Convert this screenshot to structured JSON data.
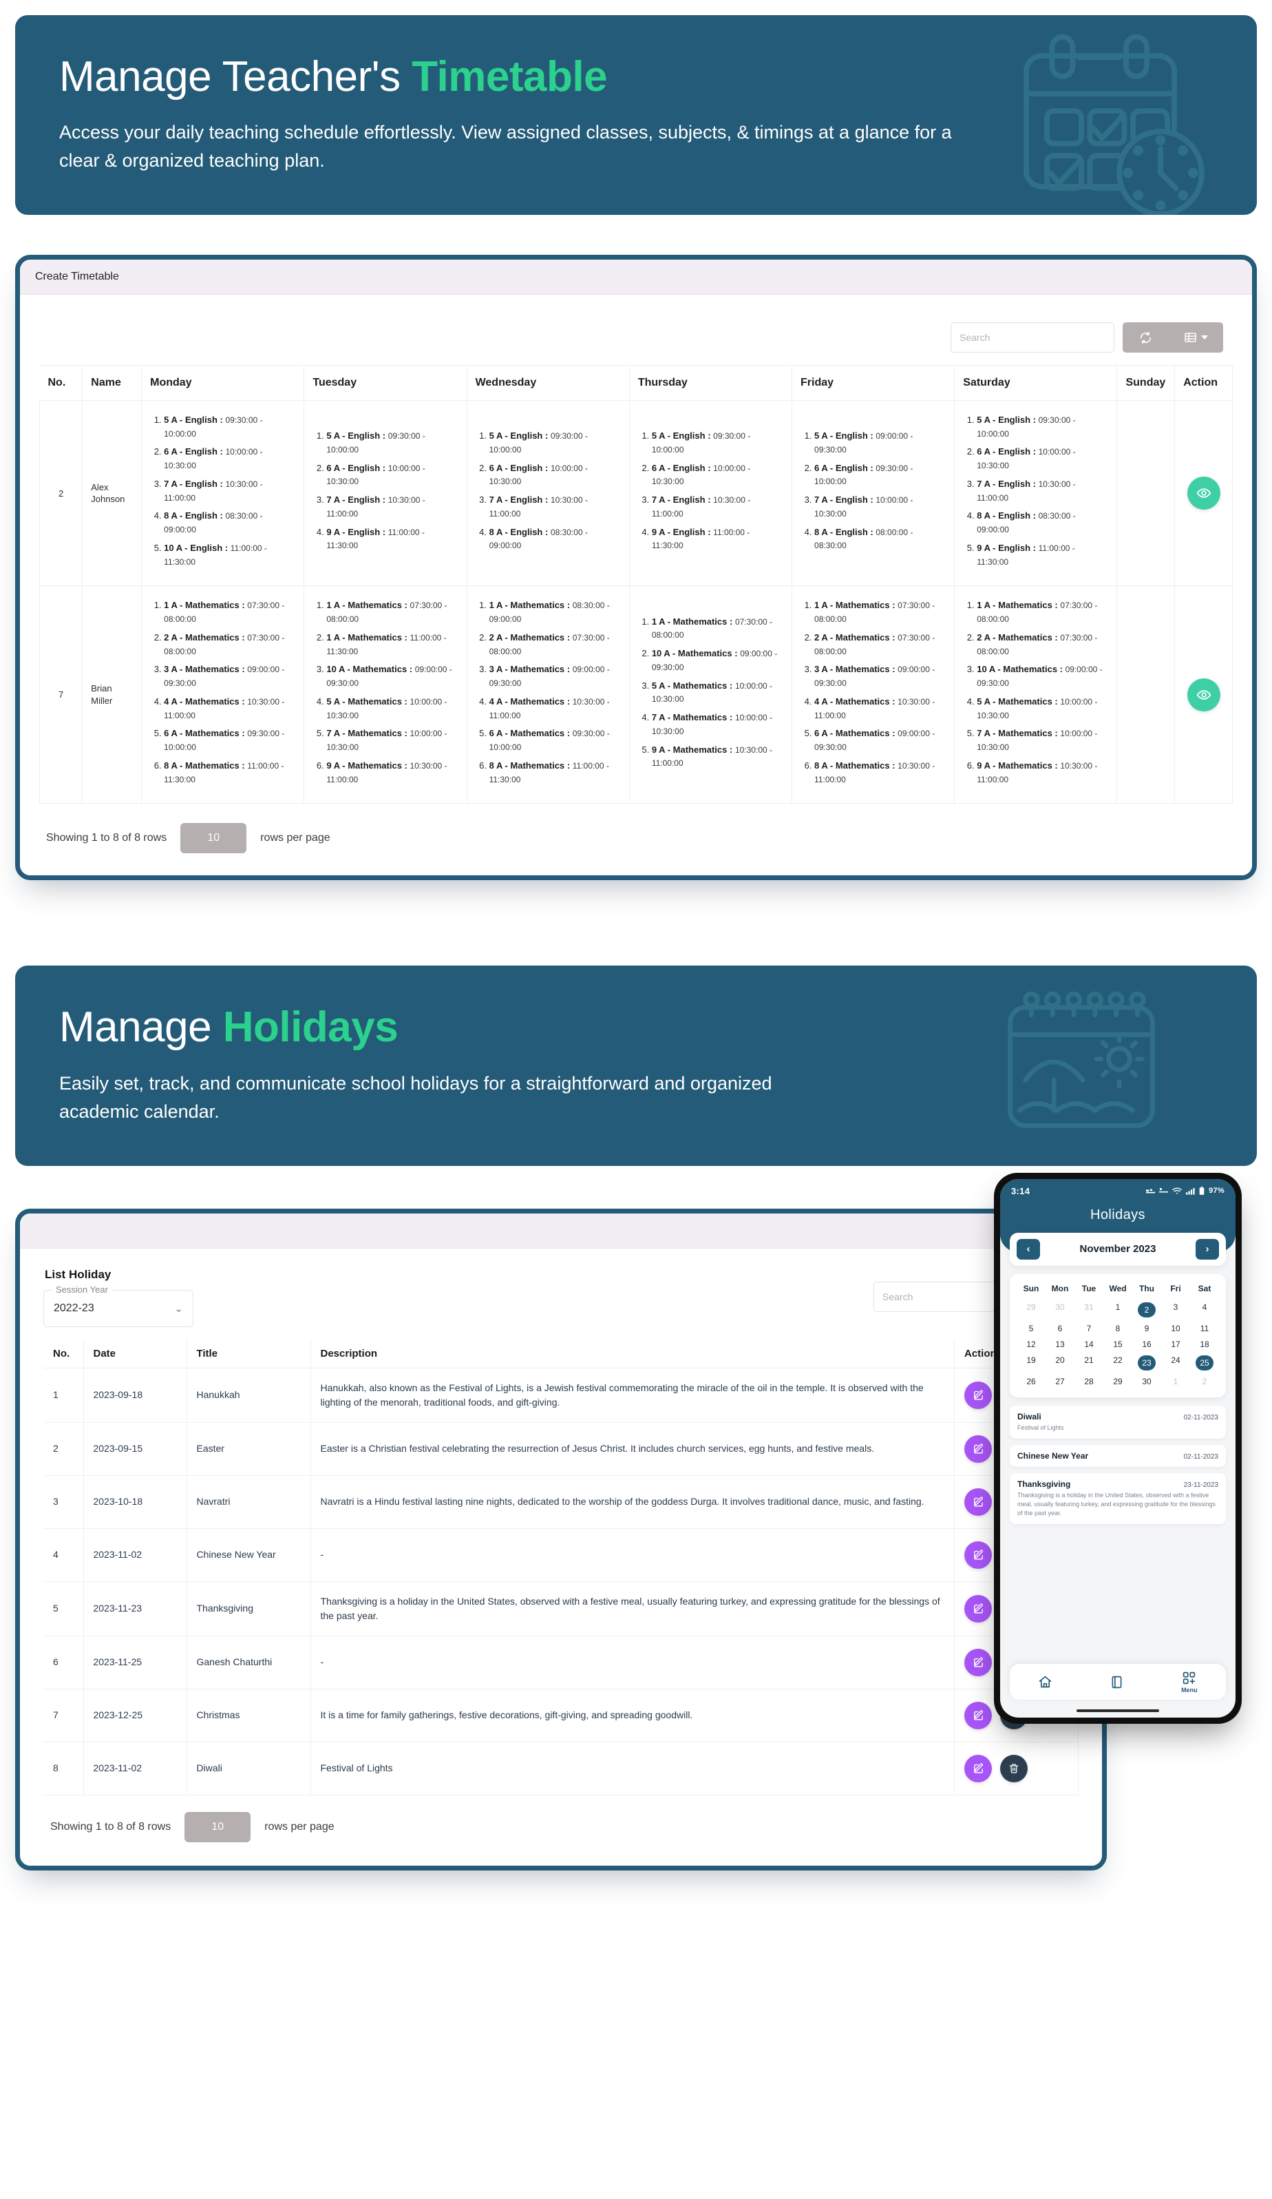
{
  "colors": {
    "brand_blue": "#245b78",
    "accent_green": "#2bd18d",
    "eye_button": "#3fcfa6",
    "edit_button": "#a855f7",
    "delete_button": "#2c3e50"
  },
  "hero_timetable": {
    "title_plain": "Manage Teacher's ",
    "title_accent": "Timetable",
    "subtitle": "Access your daily teaching schedule effortlessly. View assigned classes, subjects, & timings at a glance for a clear & organized teaching plan.",
    "art_icon": "calendar-clock-icon"
  },
  "hero_holidays": {
    "title_plain": "Manage ",
    "title_accent": "Holidays",
    "subtitle": "Easily set, track, and communicate school holidays for a straightforward and organized academic calendar.",
    "art_icon": "beach-calendar-icon"
  },
  "timetable_card": {
    "header": "Create Timetable",
    "toolbar": {
      "search_placeholder": "Search",
      "refresh_icon": "refresh-icon",
      "columns_icon": "columns-list-icon",
      "caret_icon": "chevron-down-icon"
    },
    "columns": [
      "No.",
      "Name",
      "Monday",
      "Tuesday",
      "Wednesday",
      "Thursday",
      "Friday",
      "Saturday",
      "Sunday",
      "Action"
    ],
    "rows": [
      {
        "no": "2",
        "name": "Alex Johnson",
        "monday": [
          {
            "cls": "5 A - English :",
            "time": "09:30:00 - 10:00:00"
          },
          {
            "cls": "6 A - English :",
            "time": "10:00:00 - 10:30:00"
          },
          {
            "cls": "7 A - English :",
            "time": "10:30:00 - 11:00:00"
          },
          {
            "cls": "8 A - English :",
            "time": "08:30:00 - 09:00:00"
          },
          {
            "cls": "10 A - English :",
            "time": "11:00:00 - 11:30:00"
          }
        ],
        "tuesday": [
          {
            "cls": "5 A - English :",
            "time": "09:30:00 - 10:00:00"
          },
          {
            "cls": "6 A - English :",
            "time": "10:00:00 - 10:30:00"
          },
          {
            "cls": "7 A - English :",
            "time": "10:30:00 - 11:00:00"
          },
          {
            "cls": "9 A - English :",
            "time": "11:00:00 - 11:30:00"
          }
        ],
        "wednesday": [
          {
            "cls": "5 A - English :",
            "time": "09:30:00 - 10:00:00"
          },
          {
            "cls": "6 A - English :",
            "time": "10:00:00 - 10:30:00"
          },
          {
            "cls": "7 A - English :",
            "time": "10:30:00 - 11:00:00"
          },
          {
            "cls": "8 A - English :",
            "time": "08:30:00 - 09:00:00"
          }
        ],
        "thursday": [
          {
            "cls": "5 A - English :",
            "time": "09:30:00 - 10:00:00"
          },
          {
            "cls": "6 A - English :",
            "time": "10:00:00 - 10:30:00"
          },
          {
            "cls": "7 A - English :",
            "time": "10:30:00 - 11:00:00"
          },
          {
            "cls": "9 A - English :",
            "time": "11:00:00 - 11:30:00"
          }
        ],
        "friday": [
          {
            "cls": "5 A - English :",
            "time": "09:00:00 - 09:30:00"
          },
          {
            "cls": "6 A - English :",
            "time": "09:30:00 - 10:00:00"
          },
          {
            "cls": "7 A - English :",
            "time": "10:00:00 - 10:30:00"
          },
          {
            "cls": "8 A - English :",
            "time": "08:00:00 - 08:30:00"
          }
        ],
        "saturday": [
          {
            "cls": "5 A - English :",
            "time": "09:30:00 - 10:00:00"
          },
          {
            "cls": "6 A - English :",
            "time": "10:00:00 - 10:30:00"
          },
          {
            "cls": "7 A - English :",
            "time": "10:30:00 - 11:00:00"
          },
          {
            "cls": "8 A - English :",
            "time": "08:30:00 - 09:00:00"
          },
          {
            "cls": "9 A - English :",
            "time": "11:00:00 - 11:30:00"
          }
        ],
        "sunday": [],
        "action_icon": "eye-icon"
      },
      {
        "no": "7",
        "name": "Brian Miller",
        "monday": [
          {
            "cls": "1 A - Mathematics :",
            "time": "07:30:00 - 08:00:00"
          },
          {
            "cls": "2 A - Mathematics :",
            "time": "07:30:00 - 08:00:00"
          },
          {
            "cls": "3 A - Mathematics :",
            "time": "09:00:00 - 09:30:00"
          },
          {
            "cls": "4 A - Mathematics :",
            "time": "10:30:00 - 11:00:00"
          },
          {
            "cls": "6 A - Mathematics :",
            "time": "09:30:00 - 10:00:00"
          },
          {
            "cls": "8 A - Mathematics :",
            "time": "11:00:00 - 11:30:00"
          }
        ],
        "tuesday": [
          {
            "cls": "1 A - Mathematics :",
            "time": "07:30:00 - 08:00:00"
          },
          {
            "cls": "1 A - Mathematics :",
            "time": "11:00:00 - 11:30:00"
          },
          {
            "cls": "10 A - Mathematics :",
            "time": "09:00:00 - 09:30:00"
          },
          {
            "cls": "5 A - Mathematics :",
            "time": "10:00:00 - 10:30:00"
          },
          {
            "cls": "7 A - Mathematics :",
            "time": "10:00:00 - 10:30:00"
          },
          {
            "cls": "9 A - Mathematics :",
            "time": "10:30:00 - 11:00:00"
          }
        ],
        "wednesday": [
          {
            "cls": "1 A - Mathematics :",
            "time": "08:30:00 - 09:00:00"
          },
          {
            "cls": "2 A - Mathematics :",
            "time": "07:30:00 - 08:00:00"
          },
          {
            "cls": "3 A - Mathematics :",
            "time": "09:00:00 - 09:30:00"
          },
          {
            "cls": "4 A - Mathematics :",
            "time": "10:30:00 - 11:00:00"
          },
          {
            "cls": "6 A - Mathematics :",
            "time": "09:30:00 - 10:00:00"
          },
          {
            "cls": "8 A - Mathematics :",
            "time": "11:00:00 - 11:30:00"
          }
        ],
        "thursday": [
          {
            "cls": "1 A - Mathematics :",
            "time": "07:30:00 - 08:00:00"
          },
          {
            "cls": "10 A - Mathematics :",
            "time": "09:00:00 - 09:30:00"
          },
          {
            "cls": "5 A - Mathematics :",
            "time": "10:00:00 - 10:30:00"
          },
          {
            "cls": "7 A - Mathematics :",
            "time": "10:00:00 - 10:30:00"
          },
          {
            "cls": "9 A - Mathematics :",
            "time": "10:30:00 - 11:00:00"
          }
        ],
        "friday": [
          {
            "cls": "1 A - Mathematics :",
            "time": "07:30:00 - 08:00:00"
          },
          {
            "cls": "2 A - Mathematics :",
            "time": "07:30:00 - 08:00:00"
          },
          {
            "cls": "3 A - Mathematics :",
            "time": "09:00:00 - 09:30:00"
          },
          {
            "cls": "4 A - Mathematics :",
            "time": "10:30:00 - 11:00:00"
          },
          {
            "cls": "6 A - Mathematics :",
            "time": "09:00:00 - 09:30:00"
          },
          {
            "cls": "8 A - Mathematics :",
            "time": "10:30:00 - 11:00:00"
          }
        ],
        "saturday": [
          {
            "cls": "1 A - Mathematics :",
            "time": "07:30:00 - 08:00:00"
          },
          {
            "cls": "2 A - Mathematics :",
            "time": "07:30:00 - 08:00:00"
          },
          {
            "cls": "10 A - Mathematics :",
            "time": "09:00:00 - 09:30:00"
          },
          {
            "cls": "5 A - Mathematics :",
            "time": "10:00:00 - 10:30:00"
          },
          {
            "cls": "7 A - Mathematics :",
            "time": "10:00:00 - 10:30:00"
          },
          {
            "cls": "9 A - Mathematics :",
            "time": "10:30:00 - 11:00:00"
          }
        ],
        "sunday": [],
        "action_icon": "eye-icon"
      }
    ],
    "footer": {
      "showing": "Showing 1 to 8 of 8 rows",
      "rows_per_page_value": "10",
      "rows_per_page_label": "rows per page"
    }
  },
  "holiday_card": {
    "title": "List Holiday",
    "session_year_label": "Session Year",
    "session_year_value": "2022-23",
    "search_placeholder": "Search",
    "refresh_icon": "refresh-icon",
    "columns": [
      "No.",
      "Date",
      "Title",
      "Description",
      "Action"
    ],
    "rows": [
      {
        "no": "1",
        "date": "2023-09-18",
        "title": "Hanukkah",
        "desc": "Hanukkah, also known as the Festival of Lights, is a Jewish festival commemorating the miracle of the oil in the temple. It is observed with the lighting of the menorah, traditional foods, and gift-giving."
      },
      {
        "no": "2",
        "date": "2023-09-15",
        "title": "Easter",
        "desc": "Easter is a Christian festival celebrating the resurrection of Jesus Christ. It includes church services, egg hunts, and festive meals."
      },
      {
        "no": "3",
        "date": "2023-10-18",
        "title": "Navratri",
        "desc": "Navratri is a Hindu festival lasting nine nights, dedicated to the worship of the goddess Durga. It involves traditional dance, music, and fasting."
      },
      {
        "no": "4",
        "date": "2023-11-02",
        "title": "Chinese New Year",
        "desc": "-"
      },
      {
        "no": "5",
        "date": "2023-11-23",
        "title": "Thanksgiving",
        "desc": "Thanksgiving is a holiday in the United States, observed with a festive meal, usually featuring turkey, and expressing gratitude for the blessings of the past year."
      },
      {
        "no": "6",
        "date": "2023-11-25",
        "title": "Ganesh Chaturthi",
        "desc": "-"
      },
      {
        "no": "7",
        "date": "2023-12-25",
        "title": "Christmas",
        "desc": "It is a time for family gatherings, festive decorations, gift-giving, and spreading goodwill."
      },
      {
        "no": "8",
        "date": "2023-11-02",
        "title": "Diwali",
        "desc": "Festival of Lights"
      }
    ],
    "edit_icon": "edit-icon",
    "delete_icon": "trash-icon",
    "footer": {
      "showing": "Showing 1 to 8 of 8 rows",
      "rows_per_page_value": "10",
      "rows_per_page_label": "rows per page"
    }
  },
  "phone": {
    "status_time": "3:14",
    "status_battery": "97%",
    "app_title": "Holidays",
    "prev_icon": "chevron-left-icon",
    "next_icon": "chevron-right-icon",
    "month_label": "November 2023",
    "dow": [
      "Sun",
      "Mon",
      "Tue",
      "Wed",
      "Thu",
      "Fri",
      "Sat"
    ],
    "days": [
      {
        "d": "29",
        "muted": true
      },
      {
        "d": "30",
        "muted": true
      },
      {
        "d": "31",
        "muted": true
      },
      {
        "d": "1"
      },
      {
        "d": "2",
        "sel": true
      },
      {
        "d": "3"
      },
      {
        "d": "4"
      },
      {
        "d": "5"
      },
      {
        "d": "6"
      },
      {
        "d": "7"
      },
      {
        "d": "8"
      },
      {
        "d": "9"
      },
      {
        "d": "10"
      },
      {
        "d": "11"
      },
      {
        "d": "12"
      },
      {
        "d": "13"
      },
      {
        "d": "14"
      },
      {
        "d": "15"
      },
      {
        "d": "16"
      },
      {
        "d": "17"
      },
      {
        "d": "18"
      },
      {
        "d": "19"
      },
      {
        "d": "20"
      },
      {
        "d": "21"
      },
      {
        "d": "22"
      },
      {
        "d": "23",
        "sel": true
      },
      {
        "d": "24"
      },
      {
        "d": "25",
        "sel": true
      },
      {
        "d": "26"
      },
      {
        "d": "27"
      },
      {
        "d": "28"
      },
      {
        "d": "29"
      },
      {
        "d": "30"
      },
      {
        "d": "1",
        "muted": true
      },
      {
        "d": "2",
        "muted": true
      }
    ],
    "events": [
      {
        "name": "Diwali",
        "date": "02-11-2023",
        "desc": "Festival of Lights"
      },
      {
        "name": "Chinese New Year",
        "date": "02-11-2023",
        "desc": ""
      },
      {
        "name": "Thanksgiving",
        "date": "23-11-2023",
        "desc": "Thanksgiving is a holiday in the United States, observed with a festive meal, usually featuring turkey, and expressing gratitude for the blessings of the past year."
      }
    ],
    "nav": [
      {
        "label": "",
        "icon": "home-icon"
      },
      {
        "label": "",
        "icon": "book-icon"
      },
      {
        "label": "Menu",
        "icon": "menu-grid-icon"
      }
    ]
  }
}
